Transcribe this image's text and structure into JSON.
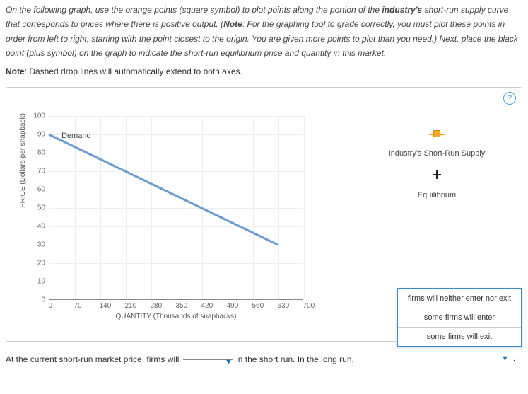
{
  "instructions_html": "On the following graph, use the orange points (square symbol) to plot points along the portion of the <b>industry's</b> short-run supply curve that corresponds to prices where there is positive output. (<b>Note</b>: For the graphing tool to grade correctly, you must plot these points in order from left to right, starting with the point closest to the origin. You are given more points to plot than you need.) Next, place the black point (plus symbol) on the graph to indicate the short-run equilibrium price and quantity in this market.",
  "note_line": "<b>Note</b>: Dashed drop lines will automatically extend to both axes.",
  "help_label": "?",
  "legend": {
    "supply_label": "Industry's Short-Run Supply",
    "equilibrium_label": "Equilibrium"
  },
  "demand_label": "Demand",
  "sentence": {
    "part1": "At the current short-run market price, firms will",
    "part2": "in the short run. In the long run,"
  },
  "dropdown_options": [
    "firms will neither enter nor exit",
    "some firms will enter",
    "some firms will exit"
  ],
  "chart_data": {
    "type": "line",
    "title": "",
    "xlabel": "QUANTITY (Thousands of snapbacks)",
    "ylabel": "PRICE (Dollars per snapback)",
    "xlim": [
      0,
      700
    ],
    "ylim": [
      0,
      100
    ],
    "x_ticks": [
      0,
      70,
      140,
      210,
      280,
      350,
      420,
      490,
      560,
      630,
      700
    ],
    "y_ticks": [
      0,
      10,
      20,
      30,
      40,
      50,
      60,
      70,
      80,
      90,
      100
    ],
    "series": [
      {
        "name": "Demand",
        "x": [
          0,
          630
        ],
        "values": [
          90,
          30
        ]
      }
    ],
    "legend_tools": [
      {
        "name": "Industry's Short-Run Supply",
        "symbol": "orange-square"
      },
      {
        "name": "Equilibrium",
        "symbol": "black-plus"
      }
    ]
  }
}
